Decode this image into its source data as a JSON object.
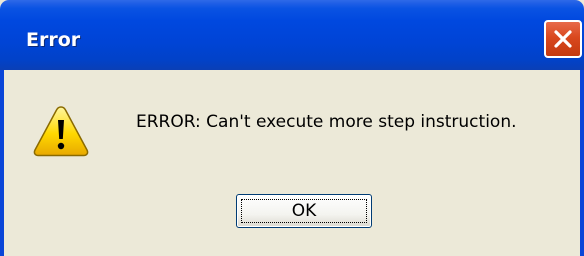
{
  "window": {
    "title": "Error",
    "title_color": "#ffffff",
    "titlebar_color": "#0048df",
    "body_color": "#ece9d8"
  },
  "dialog": {
    "icon": "warning-icon",
    "message": "ERROR: Can't execute more step instruction.",
    "ok_label": "OK"
  },
  "controls": {
    "close_icon": "close-icon",
    "close_color": "#d9481e"
  }
}
